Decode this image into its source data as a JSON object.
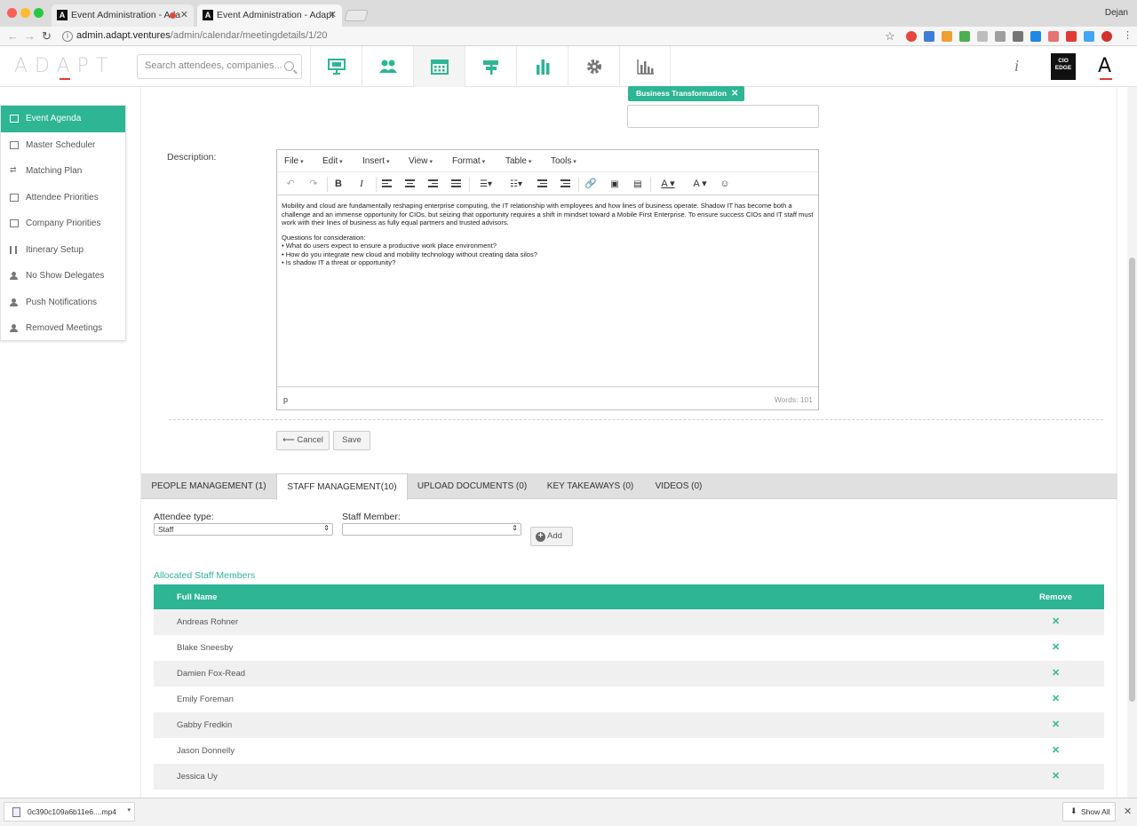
{
  "browser": {
    "tabs": [
      {
        "title": "Event Administration - Ada"
      },
      {
        "title": "Event Administration - Adapt"
      }
    ],
    "user": "Dejan",
    "url_host": "admin.adapt.ventures",
    "url_path": "/admin/calendar/meetingdetails/1/20"
  },
  "header": {
    "logo": "ADAPT",
    "search_placeholder": "Search attendees, companies...",
    "nav_icons": [
      "presentation-icon",
      "people-icon",
      "calendar-icon",
      "signpost-icon",
      "bar-chart-icon",
      "gear-icon",
      "analytics-icon"
    ],
    "info": "i",
    "cio_logo": [
      "CIO",
      "EDGE"
    ],
    "brand_letter": "A"
  },
  "sidebar": {
    "items": [
      {
        "label": "Event Agenda",
        "icon": "calendar-icon",
        "active": true
      },
      {
        "label": "Master Scheduler",
        "icon": "grid-icon"
      },
      {
        "label": "Matching Plan",
        "icon": "swap-icon"
      },
      {
        "label": "Attendee Priorities",
        "icon": "list-icon"
      },
      {
        "label": "Company Priorities",
        "icon": "list-icon"
      },
      {
        "label": "Itinerary Setup",
        "icon": "bars-icon"
      },
      {
        "label": "No Show Delegates",
        "icon": "person-icon"
      },
      {
        "label": "Push Notifications",
        "icon": "person-icon"
      },
      {
        "label": "Removed Meetings",
        "icon": "person-icon"
      }
    ]
  },
  "form": {
    "tag": "Business Transformation",
    "description_label": "Description:",
    "editor": {
      "menus": [
        "File",
        "Edit",
        "Insert",
        "View",
        "Format",
        "Table",
        "Tools"
      ],
      "paragraph1": "Mobility and cloud are fundamentally reshaping enterprise computing, the IT relationship with employees and how lines of business operate. Shadow IT has become both a challenge and an immense opportunity for CIOs, but seizing that opportunity requires a shift in mindset toward a Mobile First Enterprise. To ensure success CIOs and IT staff must work with their lines of business as fully equal partners and trusted advisors.",
      "questions_title": "Questions for consideration:",
      "questions": [
        "• What do users expect to ensure a productive work place environment?",
        "• How do you integrate new cloud and mobility technology without creating data silos?",
        "• Is shadow IT a threat or opportunity?"
      ],
      "path": "p",
      "words": "Words: 101"
    },
    "cancel_label": "Cancel",
    "save_label": "Save"
  },
  "subtabs": [
    {
      "label": "PEOPLE MANAGEMENT (1)"
    },
    {
      "label": "STAFF MANAGEMENT(10)",
      "active": true
    },
    {
      "label": "UPLOAD DOCUMENTS (0)"
    },
    {
      "label": "KEY TAKEAWAYS (0)"
    },
    {
      "label": "VIDEOS (0)"
    }
  ],
  "staff": {
    "attendee_type_label": "Attendee type:",
    "attendee_type_value": "Staff",
    "staff_member_label": "Staff Member:",
    "staff_member_value": "",
    "add_label": "Add",
    "allocated_title": "Allocated Staff Members",
    "col_full_name": "Full Name",
    "col_remove": "Remove",
    "remove_symbol": "✕",
    "members": [
      "Andreas Rohner",
      "Blake Sneesby",
      "Damien Fox-Read",
      "Emily Foreman",
      "Gabby Fredkin",
      "Jason Donnelly",
      "Jessica Uy"
    ]
  },
  "downloads": {
    "file": "0c390c109a6b11e6....mp4",
    "show_all": "Show All"
  },
  "colors": {
    "accent": "#2db594",
    "brand_red": "#e53935"
  }
}
